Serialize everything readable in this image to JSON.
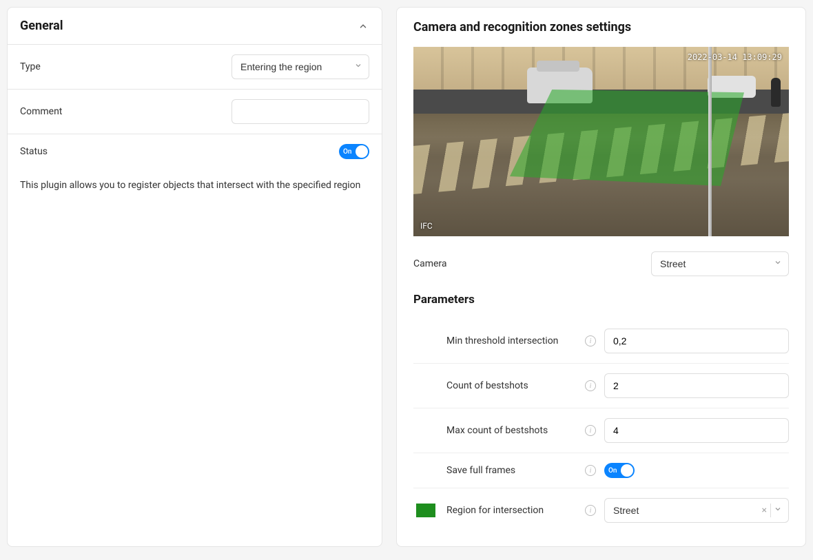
{
  "general": {
    "title": "General",
    "type_label": "Type",
    "type_value": "Entering the region",
    "comment_label": "Comment",
    "comment_value": "",
    "status_label": "Status",
    "status_on": "On",
    "description": "This plugin allows you to register objects that intersect with the specified region"
  },
  "zones": {
    "title": "Camera and recognition zones settings",
    "preview_timestamp": "2022-03-14 13:09:29",
    "preview_label": "IFC",
    "camera_label": "Camera",
    "camera_value": "Street",
    "parameters_title": "Parameters",
    "params": {
      "min_threshold_label": "Min threshold intersection",
      "min_threshold_value": "0,2",
      "count_bestshots_label": "Count of bestshots",
      "count_bestshots_value": "2",
      "max_bestshots_label": "Max count of bestshots",
      "max_bestshots_value": "4",
      "save_frames_label": "Save full frames",
      "save_frames_on": "On",
      "region_label": "Region for intersection",
      "region_value": "Street",
      "region_color": "#1e8e1e"
    }
  }
}
